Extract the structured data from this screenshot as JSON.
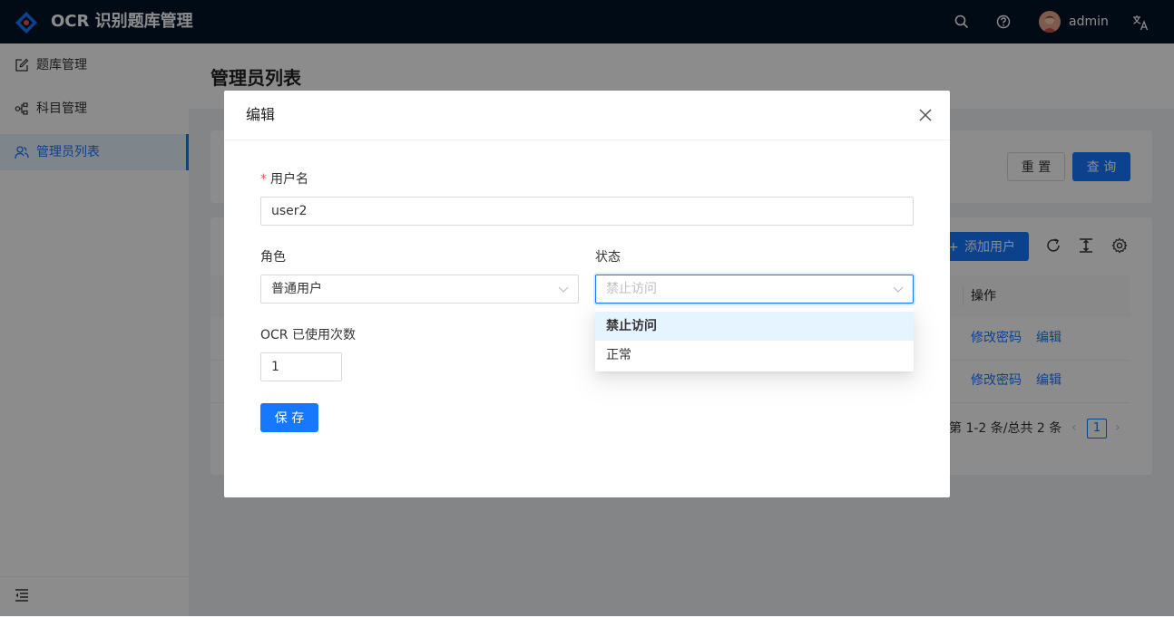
{
  "app": {
    "title": "OCR 识别题库管理",
    "user": "admin"
  },
  "colors": {
    "header_bg": "#001529",
    "primary": "#1677ff",
    "danger": "#ff4d4f"
  },
  "header_icons": [
    "search-icon",
    "question-icon",
    "avatar",
    "translate-icon"
  ],
  "sidebar": {
    "items": [
      {
        "label": "题库管理",
        "icon": "edit-icon"
      },
      {
        "label": "科目管理",
        "icon": "cluster-icon"
      },
      {
        "label": "管理员列表",
        "icon": "team-icon",
        "active": true
      }
    ],
    "collapse_icon": "menu-fold-icon"
  },
  "page": {
    "title": "管理员列表",
    "search": {
      "reset": "重 置",
      "query": "查 询"
    },
    "toolbar": {
      "add": "添加用户"
    },
    "table": {
      "header_action": "操作",
      "rows": [
        {
          "change_pwd": "修改密码",
          "edit": "编辑"
        },
        {
          "change_pwd": "修改密码",
          "edit": "编辑"
        }
      ]
    },
    "pagination": {
      "summary": "第 1-2 条/总共 2 条",
      "current": "1"
    }
  },
  "modal": {
    "title": "编辑",
    "username_label": "用户名",
    "username_value": "user2",
    "role_label": "角色",
    "role_value": "普通用户",
    "status_label": "状态",
    "status_placeholder": "禁止访问",
    "ocr_label": "OCR 已使用次数",
    "ocr_value": "1",
    "save": "保 存",
    "status_options": [
      "禁止访问",
      "正常"
    ]
  }
}
